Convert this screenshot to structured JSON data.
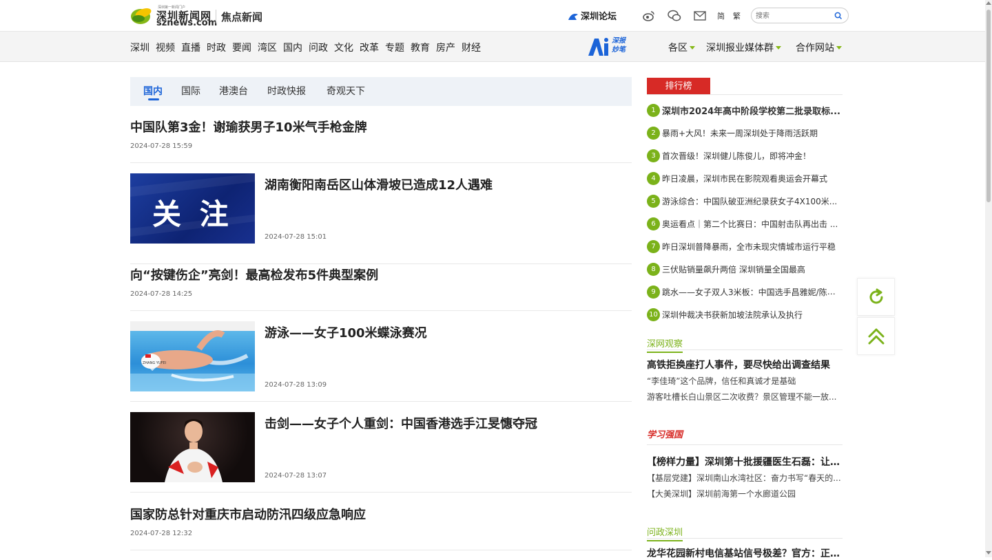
{
  "header": {
    "logo_cn": "深圳新闻网",
    "logo_en": "sznews.com",
    "logo_tagline": "深圳第一新闻门户",
    "section_title": "焦点新闻",
    "forum_label": "深圳论坛",
    "icons": [
      "weibo-icon",
      "wechat-icon",
      "mail-icon"
    ],
    "lang_simplified": "简",
    "lang_traditional": "繁",
    "search_placeholder": "搜索"
  },
  "nav": {
    "items": [
      "深圳",
      "视频",
      "直播",
      "时政",
      "要闻",
      "湾区",
      "国内",
      "问政",
      "文化",
      "改革",
      "专题",
      "教育",
      "房产",
      "财经"
    ],
    "ai_logo_line1": "深报",
    "ai_logo_line2": "妙笔",
    "right": [
      "各区",
      "深圳报业媒体群",
      "合作网站"
    ]
  },
  "tabs": [
    "国内",
    "国际",
    "港澳台",
    "时政快报",
    "奇观天下"
  ],
  "active_tab": "国内",
  "articles": [
    {
      "title": "中国队第3金！谢瑜获男子10米气手枪金牌",
      "date": "2024-07-28 15:59",
      "has_image": false
    },
    {
      "title": "湖南衡阳南岳区山体滑坡已造成12人遇难",
      "date": "2024-07-28 15:01",
      "has_image": true,
      "image_text": "关 注"
    },
    {
      "title": "向“按键伤企”亮剑！最高检发布5件典型案例",
      "date": "2024-07-28 14:25",
      "has_image": false
    },
    {
      "title": "游泳——女子100米蝶泳赛况",
      "date": "2024-07-28 13:09",
      "has_image": true,
      "image_caption": "ZHANG YUFEI"
    },
    {
      "title": "击剑——女子个人重剑：中国香港选手江旻憓夺冠",
      "date": "2024-07-28 13:07",
      "has_image": true
    },
    {
      "title": "国家防总针对重庆市启动防汛四级应急响应",
      "date": "2024-07-28 12:32",
      "has_image": false
    }
  ],
  "ranking": {
    "title": "排行榜",
    "items": [
      {
        "num": "1",
        "text": "深圳市2024年高中阶段学校第二批录取标..."
      },
      {
        "num": "2",
        "text": "暴雨+大风！未来一周深圳处于降雨活跃期"
      },
      {
        "num": "3",
        "text": "首次晋级！深圳健儿陈俊儿，即将冲金！"
      },
      {
        "num": "4",
        "text": "昨日凌晨，深圳市民在影院观看奥运会开幕式"
      },
      {
        "num": "5",
        "text": "游泳综合：中国队破亚洲纪录获女子4X100米..."
      },
      {
        "num": "6",
        "text": "奥运看点｜第二个比赛日：中国射击队再出击 ..."
      },
      {
        "num": "7",
        "text": "昨日深圳普降暴雨，全市未现灾情城市运行平稳"
      },
      {
        "num": "8",
        "text": "三伏贴销量飙升两倍 深圳销量全国最高"
      },
      {
        "num": "9",
        "text": "跳水——女子双人3米板：中国选手昌雅妮/陈艺..."
      },
      {
        "num": "10",
        "text": "深圳仲裁决书获新加坡法院承认及执行"
      }
    ]
  },
  "observe": {
    "title": "深网观察",
    "lead": "高铁拒换座打人事件，要尽快给出调查结果",
    "lines": [
      "“李佳琦”这个品牌，信任和真诚才是基础",
      "游客吐槽长白山景区二次收费？景区管理不能一放..."
    ]
  },
  "xuexi": {
    "logo_text": "学习强国",
    "sub": "强国",
    "lead": "【榜样力量】深圳第十批援疆医生石磊：让群...",
    "lines": [
      "【基层党建】深圳南山水湾社区：奋力书写“春天的...",
      "【大美深圳】深圳前海第一个水廊道公园"
    ]
  },
  "wenzheng": {
    "title": "问政深圳",
    "lead": "龙华花园新村电信基站信号极差？官方：正在..."
  },
  "tools": {
    "refresh": "refresh-icon",
    "top": "back-to-top-icon"
  },
  "colors": {
    "accent_green": "#7bb21a",
    "accent_blue": "#1c64d8",
    "accent_red": "#d72a26"
  }
}
